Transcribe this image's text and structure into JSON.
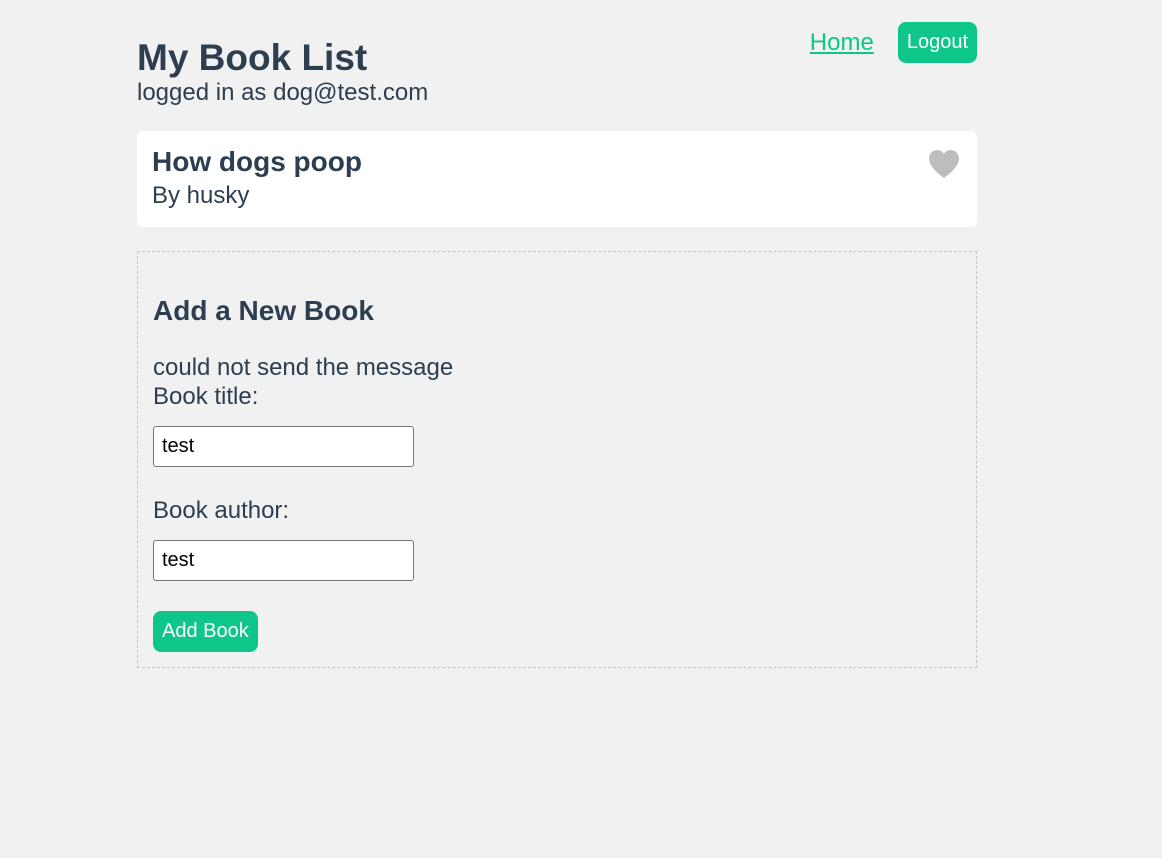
{
  "header": {
    "title": "My Book List",
    "user_line": "logged in as dog@test.com",
    "nav": {
      "home_label": "Home",
      "logout_label": "Logout"
    }
  },
  "books": [
    {
      "title": "How dogs poop",
      "author": "By husky",
      "favorite_icon": "heart-icon",
      "favorited": false
    }
  ],
  "add_form": {
    "heading": "Add a New Book",
    "error_message": "could not send the message",
    "title_label": "Book title:",
    "title_value": "test",
    "author_label": "Book author:",
    "author_value": "test",
    "submit_label": "Add Book"
  },
  "colors": {
    "accent": "#0fc68a",
    "text": "#2c3e50",
    "background": "#f1f1f1",
    "heart": "#bdbdbd"
  }
}
